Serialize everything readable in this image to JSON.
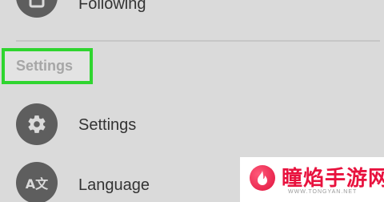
{
  "menu": {
    "following_label": "Following",
    "section_header": "Settings",
    "settings_label": "Settings",
    "language_label": "Language",
    "language_icon_text": "A文"
  },
  "watermark": {
    "brand": "瞳焰手游网",
    "url": "WWW.TONGYAN.NET"
  },
  "colors": {
    "background": "#dadada",
    "icon_circle": "#5e5e5e",
    "highlight_border": "#2fd52f",
    "watermark_red": "#e8123e"
  },
  "icons": [
    "following-icon",
    "gear-icon",
    "translate-icon",
    "flame-logo"
  ]
}
